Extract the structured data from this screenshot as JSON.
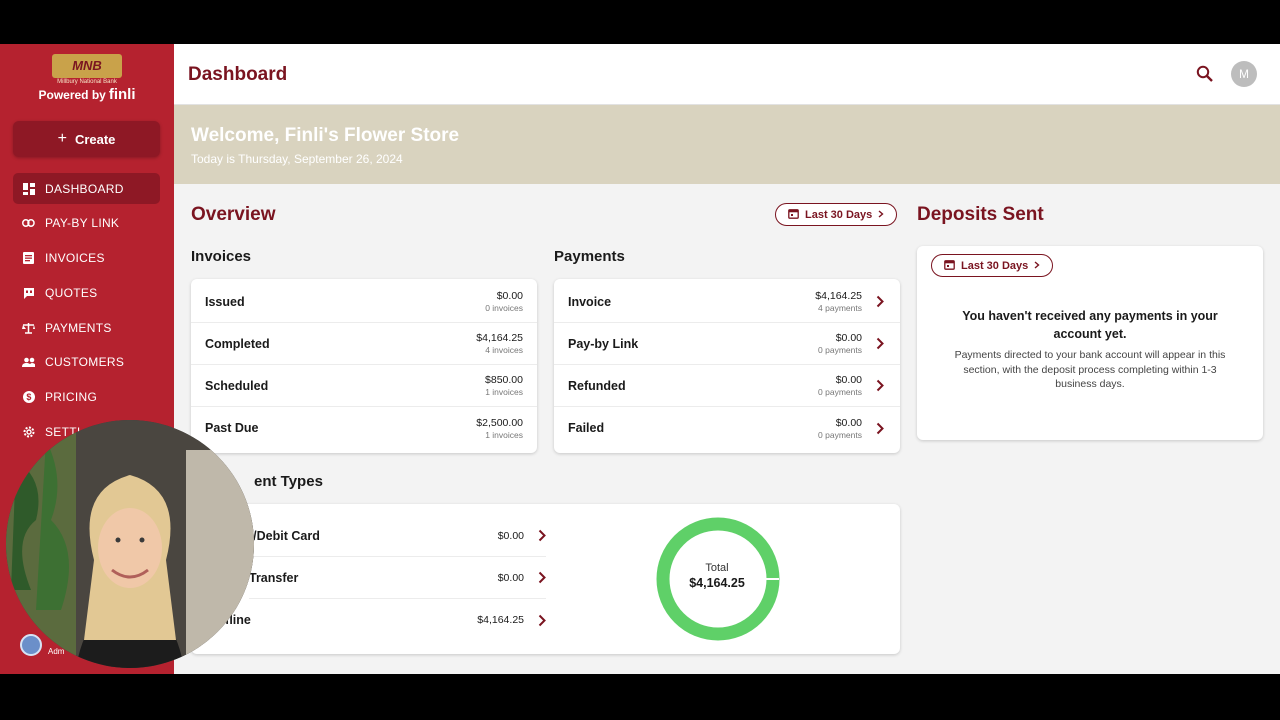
{
  "sidebar": {
    "logo_mark": "MNB",
    "logo_sub": "Millbury National Bank",
    "powered_by": "Powered by",
    "powered_brand": "finli",
    "create_label": "Create",
    "items": [
      {
        "label": "DASHBOARD",
        "icon": "grid-icon",
        "active": true
      },
      {
        "label": "PAY-BY LINK",
        "icon": "link-icon"
      },
      {
        "label": "INVOICES",
        "icon": "document-icon"
      },
      {
        "label": "QUOTES",
        "icon": "quote-icon"
      },
      {
        "label": "PAYMENTS",
        "icon": "scale-icon"
      },
      {
        "label": "CUSTOMERS",
        "icon": "people-icon"
      },
      {
        "label": "PRICING",
        "icon": "dollar-icon"
      },
      {
        "label": "SETTI",
        "icon": "gear-icon"
      }
    ],
    "user_role": "Adm"
  },
  "header": {
    "title": "Dashboard",
    "avatar_initial": "M"
  },
  "welcome": {
    "title": "Welcome, Finli's Flower Store",
    "date": "Today is Thursday, September 26, 2024"
  },
  "overview": {
    "title": "Overview",
    "range": "Last 30 Days",
    "invoices": {
      "title": "Invoices",
      "rows": [
        {
          "label": "Issued",
          "amount": "$0.00",
          "count": "0 invoices"
        },
        {
          "label": "Completed",
          "amount": "$4,164.25",
          "count": "4 invoices"
        },
        {
          "label": "Scheduled",
          "amount": "$850.00",
          "count": "1 invoices"
        },
        {
          "label": "Past Due",
          "amount": "$2,500.00",
          "count": "1 invoices"
        }
      ]
    },
    "payments": {
      "title": "Payments",
      "rows": [
        {
          "label": "Invoice",
          "amount": "$4,164.25",
          "count": "4 payments"
        },
        {
          "label": "Pay-by Link",
          "amount": "$0.00",
          "count": "0 payments"
        },
        {
          "label": "Refunded",
          "amount": "$0.00",
          "count": "0 payments"
        },
        {
          "label": "Failed",
          "amount": "$0.00",
          "count": "0 payments"
        }
      ]
    },
    "payment_types": {
      "title": "ent Types",
      "rows": [
        {
          "label": "t/Debit Card",
          "amount": "$0.00"
        },
        {
          "label": "Transfer",
          "amount": "$0.00"
        },
        {
          "label": "ffline",
          "amount": "$4,164.25"
        }
      ],
      "total_label": "Total",
      "total_value": "$4,164.25",
      "donut_color": "#5fd068"
    }
  },
  "deposits": {
    "title": "Deposits Sent",
    "range": "Last 30 Days",
    "empty_title": "You haven't received any payments in your account yet.",
    "empty_body": "Payments directed to your bank account will appear in this section, with the deposit process completing within 1-3 business days."
  },
  "colors": {
    "brand": "#b5222f",
    "brand_dark": "#7a1420",
    "banner": "#d9d3bf"
  }
}
